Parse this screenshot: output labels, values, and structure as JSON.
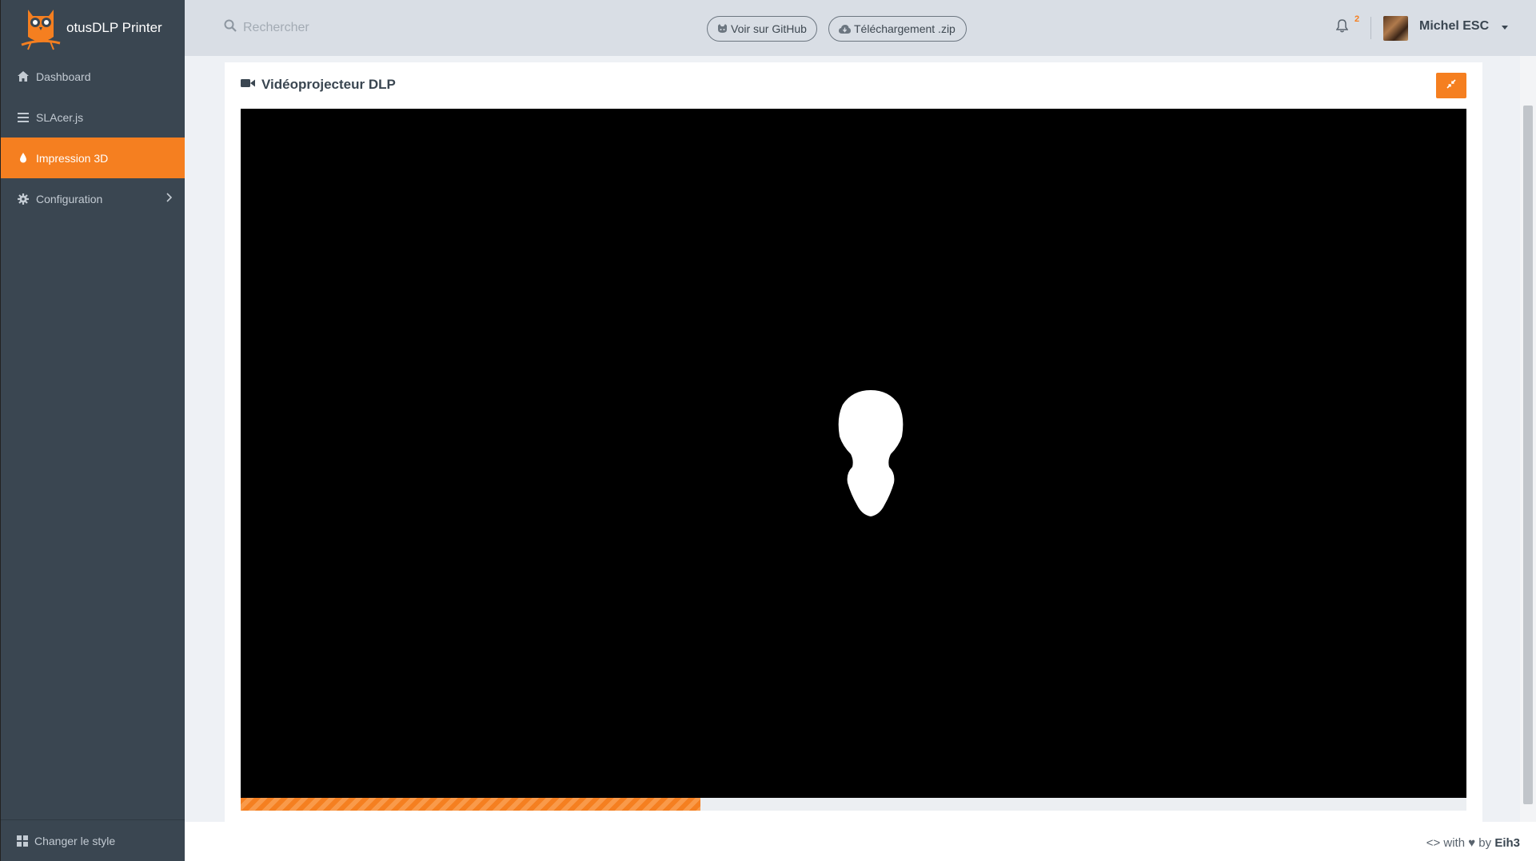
{
  "app": {
    "title": "otusDLP Printer"
  },
  "sidebar": {
    "items": [
      {
        "label": "Dashboard",
        "icon": "home-icon"
      },
      {
        "label": "SLAcer.js",
        "icon": "list-icon"
      },
      {
        "label": "Impression 3D",
        "icon": "drop-icon",
        "active": true
      },
      {
        "label": "Configuration",
        "icon": "gear-icon",
        "has_submenu": true
      }
    ],
    "footer_label": "Changer le style"
  },
  "topbar": {
    "search_placeholder": "Rechercher",
    "github_label": "Voir sur GitHub",
    "download_label": "Téléchargement .zip",
    "notification_count": "2",
    "user_name": "Michel ESC"
  },
  "panel": {
    "title": "Vidéoprojecteur DLP",
    "progress_percent": 37.5
  },
  "footer": {
    "prefix": "<> with ♥ by",
    "author": "Eih3"
  },
  "colors": {
    "accent": "#f57f20",
    "sidebar": "#3a4651",
    "topbar": "#d9dee5"
  }
}
